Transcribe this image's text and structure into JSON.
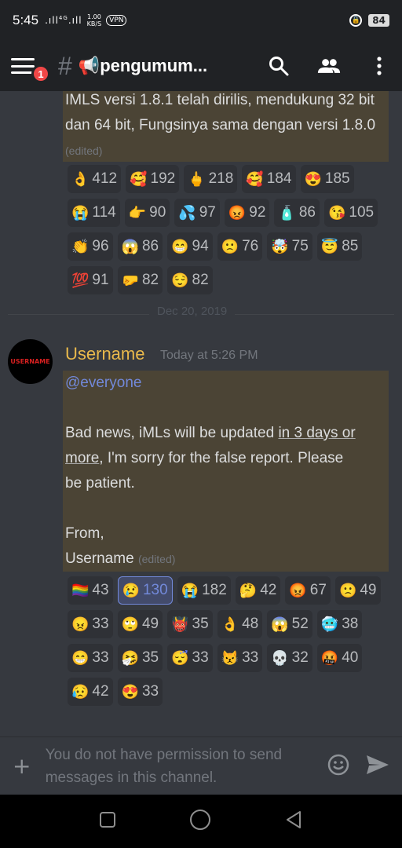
{
  "status_bar": {
    "time": "5:45",
    "signal": "4G",
    "speed_value": "1.00",
    "speed_unit": "KB/S",
    "vpn": "VPN",
    "battery": "84"
  },
  "header": {
    "notification_count": "1",
    "hash": "#",
    "channel_name": "📢pengumum..."
  },
  "first_message": {
    "text": "IMLS versi 1.8.1 telah dirilis, mendukung 32 bit dan 64 bit, Fungsinya sama dengan versi 1.8.0",
    "edited": "(edited)",
    "reactions": [
      {
        "emoji": "👌",
        "count": "412"
      },
      {
        "emoji": "🥰",
        "count": "192"
      },
      {
        "emoji": "🖕",
        "count": "218"
      },
      {
        "emoji": "🥰",
        "count": "184"
      },
      {
        "emoji": "😍",
        "count": "185"
      },
      {
        "emoji": "😭",
        "count": "114"
      },
      {
        "emoji": "👉",
        "count": "90"
      },
      {
        "emoji": "💦",
        "count": "97"
      },
      {
        "emoji": "😡",
        "count": "92"
      },
      {
        "emoji": "🧴",
        "count": "86"
      },
      {
        "emoji": "😘",
        "count": "105"
      },
      {
        "emoji": "👏",
        "count": "96"
      },
      {
        "emoji": "😱",
        "count": "86"
      },
      {
        "emoji": "😁",
        "count": "94"
      },
      {
        "emoji": "🙁",
        "count": "76"
      },
      {
        "emoji": "🤯",
        "count": "75"
      },
      {
        "emoji": "😇",
        "count": "85"
      },
      {
        "emoji": "💯",
        "count": "91"
      },
      {
        "emoji": "🤛",
        "count": "82"
      },
      {
        "emoji": "😌",
        "count": "82"
      }
    ]
  },
  "date_divider": "Dec 20, 2019",
  "second_message": {
    "avatar_text": "USERNAME",
    "username": "Username",
    "timestamp": "Today at 5:26 PM",
    "mention": "@everyone",
    "line1_pre": "Bad news, iMLs will be updated ",
    "line1_link": "in 3 days or",
    "line2_link": "more",
    "line2_post": ", I'm sorry for the false report. Please",
    "line3": "be patient.",
    "from": "From,",
    "signature": "Username",
    "edited": "(edited)",
    "reactions": [
      {
        "emoji": "🏳️‍🌈",
        "count": "43",
        "me": false
      },
      {
        "emoji": "😢",
        "count": "130",
        "me": true
      },
      {
        "emoji": "😭",
        "count": "182",
        "me": false
      },
      {
        "emoji": "🤔",
        "count": "42",
        "me": false
      },
      {
        "emoji": "😡",
        "count": "67",
        "me": false
      },
      {
        "emoji": "🙁",
        "count": "49",
        "me": false
      },
      {
        "emoji": "😠",
        "count": "33",
        "me": false
      },
      {
        "emoji": "🙄",
        "count": "49",
        "me": false
      },
      {
        "emoji": "👹",
        "count": "35",
        "me": false
      },
      {
        "emoji": "👌",
        "count": "48",
        "me": false
      },
      {
        "emoji": "😱",
        "count": "52",
        "me": false
      },
      {
        "emoji": "🥶",
        "count": "38",
        "me": false
      },
      {
        "emoji": "😁",
        "count": "33",
        "me": false
      },
      {
        "emoji": "🤧",
        "count": "35",
        "me": false
      },
      {
        "emoji": "😴",
        "count": "33",
        "me": false
      },
      {
        "emoji": "😾",
        "count": "33",
        "me": false
      },
      {
        "emoji": "💀",
        "count": "32",
        "me": false
      },
      {
        "emoji": "🤬",
        "count": "40",
        "me": false
      },
      {
        "emoji": "😥",
        "count": "42",
        "me": false
      },
      {
        "emoji": "😍",
        "count": "33",
        "me": false
      }
    ]
  },
  "input_bar": {
    "placeholder": "You do not have permission to send messages in this channel."
  },
  "colors": {
    "background": "#36393f",
    "header": "#202225",
    "highlight": "#4b4435",
    "username": "#e9b94c",
    "mention": "#7289da",
    "badge": "#f04747"
  }
}
